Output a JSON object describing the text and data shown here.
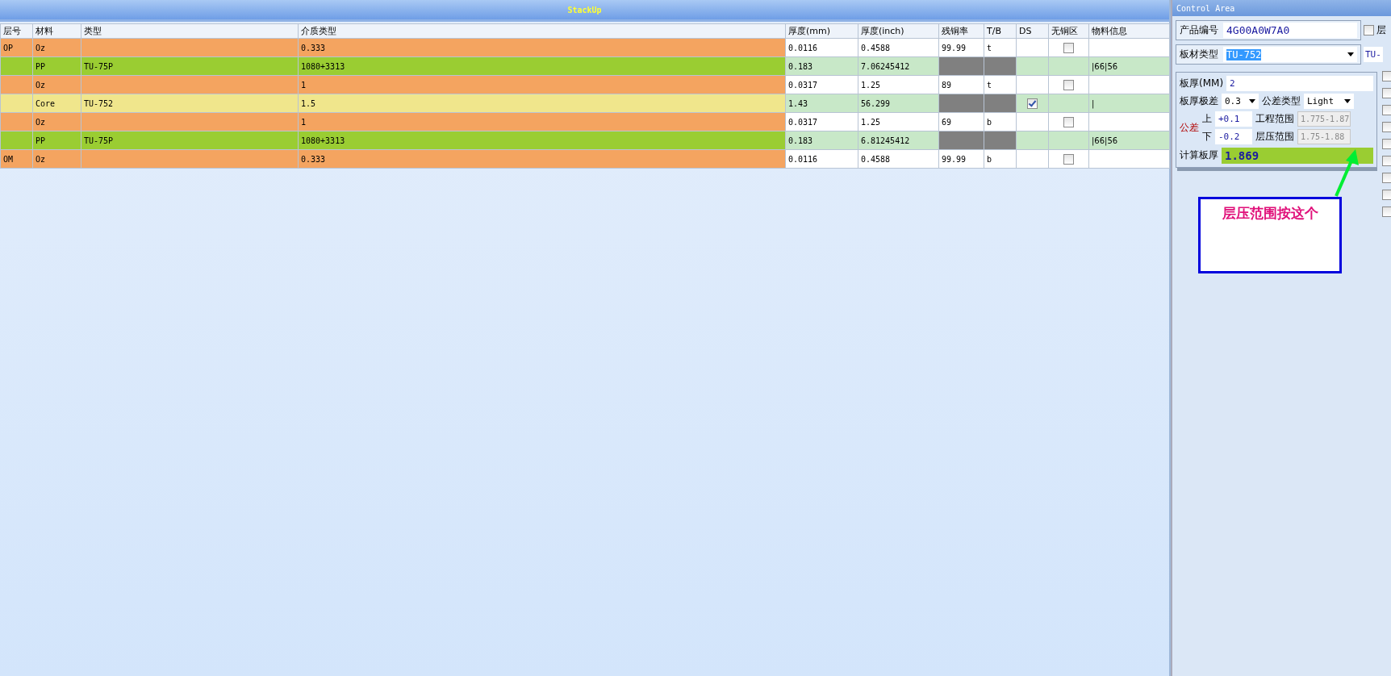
{
  "stackup": {
    "title": "StackUp",
    "columns": [
      "层号",
      "材料",
      "类型",
      "介质类型",
      "厚度(mm)",
      "厚度(inch)",
      "残铜率",
      "T/B",
      "DS",
      "无铜区",
      "物料信息"
    ],
    "rows": [
      {
        "kind": "copper",
        "layer": "OP",
        "material": "Oz",
        "type": "",
        "dielectric": "0.333",
        "thk_mm": "0.0116",
        "thk_inch": "0.4588",
        "residual": "99.99",
        "tb": "t",
        "no_copper": {
          "checked": false
        },
        "info": ""
      },
      {
        "kind": "pp",
        "layer": "",
        "material": "PP",
        "type": "TU-75P",
        "dielectric": "1080+3313",
        "thk_mm": "0.183",
        "thk_inch": "7.06245412",
        "info": "|66|56"
      },
      {
        "kind": "copper",
        "layer": "",
        "material": "Oz",
        "type": "",
        "dielectric": "1",
        "thk_mm": "0.0317",
        "thk_inch": "1.25",
        "residual": "89",
        "tb": "t",
        "no_copper": {
          "checked": false
        },
        "info": ""
      },
      {
        "kind": "core",
        "layer": "",
        "material": "Core",
        "type": "TU-752",
        "dielectric": "1.5",
        "thk_mm": "1.43",
        "thk_inch": "56.299",
        "ds": {
          "checked": true
        },
        "info": "|"
      },
      {
        "kind": "copper",
        "layer": "",
        "material": "Oz",
        "type": "",
        "dielectric": "1",
        "thk_mm": "0.0317",
        "thk_inch": "1.25",
        "residual": "69",
        "tb": "b",
        "no_copper": {
          "checked": false
        },
        "info": ""
      },
      {
        "kind": "pp",
        "layer": "",
        "material": "PP",
        "type": "TU-75P",
        "dielectric": "1080+3313",
        "thk_mm": "0.183",
        "thk_inch": "6.81245412",
        "info": "|66|56"
      },
      {
        "kind": "copper",
        "layer": "OM",
        "material": "Oz",
        "type": "",
        "dielectric": "0.333",
        "thk_mm": "0.0116",
        "thk_inch": "0.4588",
        "residual": "99.99",
        "tb": "b",
        "no_copper": {
          "checked": false
        },
        "info": ""
      }
    ]
  },
  "control_area": {
    "title": "Control Area",
    "product_no": {
      "label": "产品编号",
      "value": "4G00A0W7A0"
    },
    "side_check": {
      "checked": false,
      "label": "层"
    },
    "board_material": {
      "label": "板材类型",
      "value": "TU-752",
      "side_value": "TU-"
    },
    "thickness": {
      "label": "板厚(MM)",
      "value": "2"
    },
    "thickness_tol": {
      "label": "板厚极差",
      "value": "0.3"
    },
    "tol_type": {
      "label": "公差类型",
      "value": "Light"
    },
    "tolerance_label": "公差",
    "upper": {
      "label": "上",
      "value": "+0.1"
    },
    "lower": {
      "label": "下",
      "value": "-0.2"
    },
    "eng_range": {
      "label": "工程范围",
      "value": "1.775-1.87"
    },
    "press_range": {
      "label": "层压范围",
      "value": "1.75-1.88"
    },
    "calc": {
      "label": "计算板厚",
      "value": "1.869"
    },
    "side_checks": [
      {
        "checked": false
      },
      {
        "checked": false
      },
      {
        "checked": false
      },
      {
        "checked": false
      },
      {
        "checked": false
      },
      {
        "checked": false
      },
      {
        "checked": false
      },
      {
        "checked": false
      },
      {
        "checked": false
      }
    ],
    "note": "层压范围按这个"
  }
}
